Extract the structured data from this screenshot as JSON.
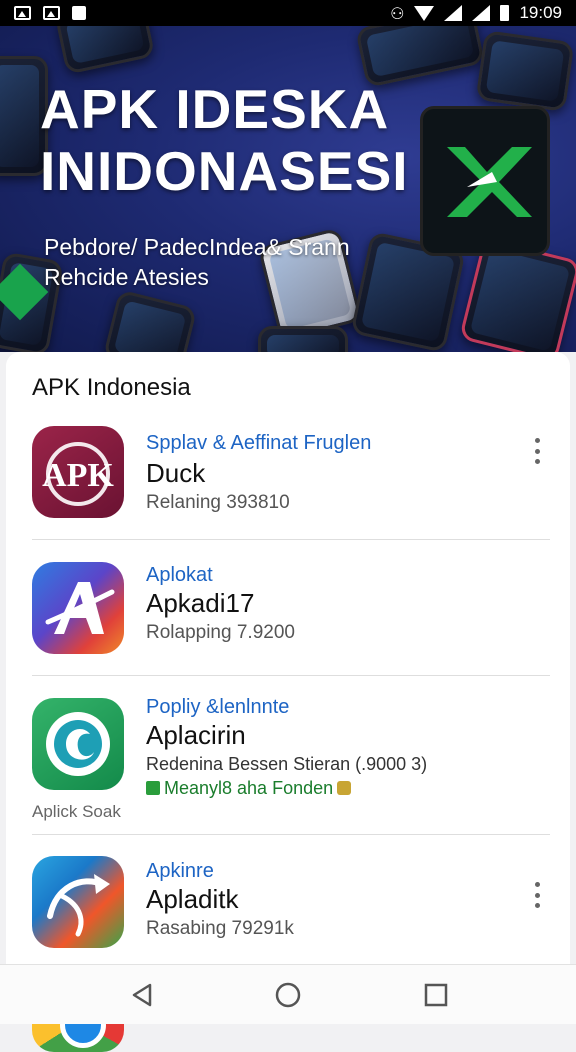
{
  "status_bar": {
    "time": "19:09"
  },
  "hero": {
    "title_line1": "APK IDESKA",
    "title_line2": "INIDONASESI",
    "subtitle_line1": "Pebdore/ PadecIndea& Srann",
    "subtitle_line2": "Rehcide Atesies"
  },
  "section": {
    "title": "APK Indonesia"
  },
  "apps": [
    {
      "category": "Spplav & Aeffinat Fruglen",
      "name": "Duck",
      "meta": "Relaning 393810"
    },
    {
      "category": "Aplokat",
      "name": "Apkadi17",
      "meta": "Rolapping 7.9200"
    },
    {
      "category": "Popliy &lenlnnte",
      "name": "Aplacirin",
      "meta": "Redenina Bessen Stieran (.9000 3)",
      "meta2": "Meanyl8 aha Fonden",
      "side_label": "Aplick Soak"
    },
    {
      "category": "Apkinre",
      "name": "Apladitk",
      "meta": "Rasabing 79291k"
    }
  ],
  "icons": {
    "app1": "apk-logo-icon",
    "app2": "letter-a-icon",
    "app3": "teal-circle-icon",
    "app4": "arrow-swirl-icon",
    "back": "back-icon",
    "home": "home-icon",
    "recents": "recents-icon"
  },
  "colors": {
    "accent_blue": "#1d64c4",
    "brand_maroon": "#8a1e3f",
    "green": "#19a34c"
  }
}
